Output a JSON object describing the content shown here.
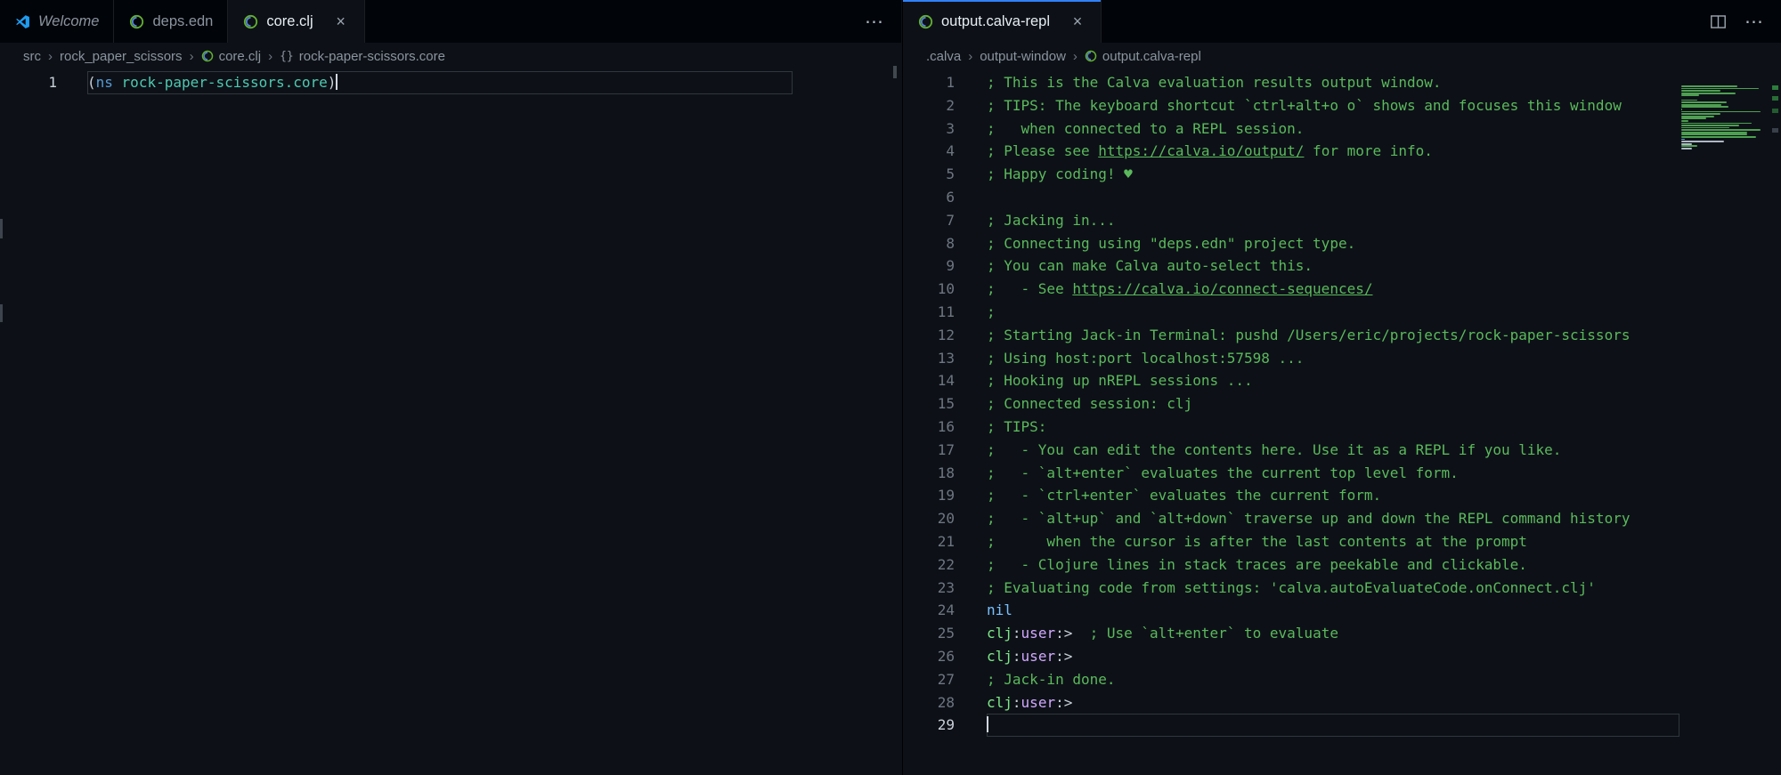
{
  "ui": {
    "crumb_sep": "›",
    "braces_glyph": "{}"
  },
  "colors": {
    "bg": "#0d1117",
    "tabbar_bg": "#010409",
    "tab_border": "#1b1f24",
    "accent": "#2f81f7",
    "text_default": "#c9d1d9",
    "text_muted": "#8b949e",
    "gutter": "#6e7681",
    "gutter_active": "#c9d1d9",
    "current_line_border": "#30363d",
    "comment_green": "#5bb95c",
    "nil_blue": "#79c0ff",
    "prompt_green": "#7ee787",
    "prompt_purple": "#d2a8ff",
    "keyword_blue": "#569cd6",
    "symbol_teal": "#4ec9b0",
    "vscode_blue": "#1f9cf0",
    "clojure_green": "#63b132",
    "clojure_blue": "#5881d8"
  },
  "actions": {
    "left_more": "⋯",
    "right_more": "⋯"
  },
  "left_group": {
    "tabs": [
      {
        "label": "Welcome",
        "icon": "vscode-logo",
        "active": false
      },
      {
        "label": "deps.edn",
        "icon": "clojure-logo",
        "active": false
      },
      {
        "label": "core.clj",
        "icon": "clojure-logo",
        "active": true,
        "close": "×"
      }
    ],
    "breadcrumb": [
      {
        "label": "src"
      },
      {
        "label": "rock_paper_scissors"
      },
      {
        "label": "core.clj",
        "icon": "clojure-logo"
      },
      {
        "label": "rock-paper-scissors.core",
        "icon": "braces"
      }
    ],
    "lines": [
      {
        "n": 1,
        "cur": true,
        "seg": [
          [
            "pl",
            "("
          ],
          [
            "kw",
            "ns"
          ],
          [
            "pl",
            " "
          ],
          [
            "sym",
            "rock-paper-scissors.core"
          ],
          [
            "pl",
            ")"
          ]
        ]
      }
    ]
  },
  "right_group": {
    "tabs": [
      {
        "label": "output.calva-repl",
        "icon": "clojure-logo",
        "active": true,
        "close": "×"
      }
    ],
    "breadcrumb": [
      {
        "label": ".calva"
      },
      {
        "label": "output-window"
      },
      {
        "label": "output.calva-repl",
        "icon": "clojure-logo"
      }
    ],
    "lines": [
      {
        "n": 1,
        "seg": [
          [
            "cm",
            "; This is the Calva evaluation results output window."
          ]
        ]
      },
      {
        "n": 2,
        "seg": [
          [
            "cm",
            "; TIPS: The keyboard shortcut `ctrl+alt+o o` shows and focuses this window"
          ]
        ]
      },
      {
        "n": 3,
        "seg": [
          [
            "cm",
            ";   when connected to a REPL session."
          ]
        ]
      },
      {
        "n": 4,
        "seg": [
          [
            "cm",
            "; Please see "
          ],
          [
            "ln",
            "https://calva.io/output/"
          ],
          [
            "cm",
            " for more info."
          ]
        ]
      },
      {
        "n": 5,
        "seg": [
          [
            "cm",
            "; Happy coding! ♥"
          ]
        ]
      },
      {
        "n": 6,
        "seg": []
      },
      {
        "n": 7,
        "seg": [
          [
            "cm",
            "; Jacking in..."
          ]
        ]
      },
      {
        "n": 8,
        "seg": [
          [
            "cm",
            "; Connecting using \"deps.edn\" project type."
          ]
        ]
      },
      {
        "n": 9,
        "seg": [
          [
            "cm",
            "; You can make Calva auto-select this."
          ]
        ]
      },
      {
        "n": 10,
        "seg": [
          [
            "cm",
            ";   - See "
          ],
          [
            "ln",
            "https://calva.io/connect-sequences/"
          ]
        ]
      },
      {
        "n": 11,
        "seg": [
          [
            "cm",
            ";"
          ]
        ]
      },
      {
        "n": 12,
        "seg": [
          [
            "cm",
            "; Starting Jack-in Terminal: pushd /Users/eric/projects/rock-paper-scissors"
          ]
        ]
      },
      {
        "n": 13,
        "seg": [
          [
            "cm",
            "; Using host:port localhost:57598 ..."
          ]
        ]
      },
      {
        "n": 14,
        "seg": [
          [
            "cm",
            "; Hooking up nREPL sessions ..."
          ]
        ]
      },
      {
        "n": 15,
        "seg": [
          [
            "cm",
            "; Connected session: clj"
          ]
        ]
      },
      {
        "n": 16,
        "seg": [
          [
            "cm",
            "; TIPS:"
          ]
        ]
      },
      {
        "n": 17,
        "seg": [
          [
            "cm",
            ";   - You can edit the contents here. Use it as a REPL if you like."
          ]
        ]
      },
      {
        "n": 18,
        "seg": [
          [
            "cm",
            ";   - `alt+enter` evaluates the current top level form."
          ]
        ]
      },
      {
        "n": 19,
        "seg": [
          [
            "cm",
            ";   - `ctrl+enter` evaluates the current form."
          ]
        ]
      },
      {
        "n": 20,
        "seg": [
          [
            "cm",
            ";   - `alt+up` and `alt+down` traverse up and down the REPL command history"
          ]
        ]
      },
      {
        "n": 21,
        "seg": [
          [
            "cm",
            ";      when the cursor is after the last contents at the prompt"
          ]
        ]
      },
      {
        "n": 22,
        "seg": [
          [
            "cm",
            ";   - Clojure lines in stack traces are peekable and clickable."
          ]
        ]
      },
      {
        "n": 23,
        "seg": [
          [
            "cm",
            "; Evaluating code from settings: 'calva.autoEvaluateCode.onConnect.clj'"
          ]
        ]
      },
      {
        "n": 24,
        "seg": [
          [
            "nil",
            "nil"
          ]
        ]
      },
      {
        "n": 25,
        "seg": [
          [
            "pc",
            "clj"
          ],
          [
            "ps",
            ":"
          ],
          [
            "pu",
            "user"
          ],
          [
            "ps",
            ":>"
          ],
          [
            "pl",
            "  "
          ],
          [
            "cm",
            "; Use `alt+enter` to evaluate"
          ]
        ]
      },
      {
        "n": 26,
        "seg": [
          [
            "pc",
            "clj"
          ],
          [
            "ps",
            ":"
          ],
          [
            "pu",
            "user"
          ],
          [
            "ps",
            ":>"
          ]
        ]
      },
      {
        "n": 27,
        "seg": [
          [
            "cm",
            "; Jack-in done."
          ]
        ]
      },
      {
        "n": 28,
        "seg": [
          [
            "pc",
            "clj"
          ],
          [
            "ps",
            ":"
          ],
          [
            "pu",
            "user"
          ],
          [
            "ps",
            ":>"
          ]
        ]
      },
      {
        "n": 29,
        "cur": true,
        "seg": []
      }
    ]
  }
}
